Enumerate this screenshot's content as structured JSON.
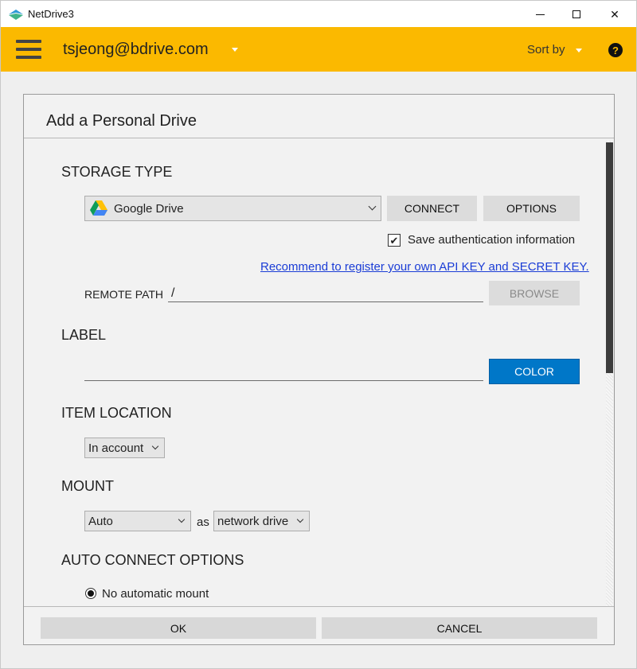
{
  "window": {
    "title": "NetDrive3"
  },
  "header": {
    "account": "tsjeong@bdrive.com",
    "sort_label": "Sort by",
    "help_glyph": "?"
  },
  "dialog": {
    "title": "Add a Personal Drive",
    "storage_type": {
      "heading": "STORAGE TYPE",
      "selected": "Google Drive",
      "connect_label": "CONNECT",
      "options_label": "OPTIONS",
      "save_auth_label": "Save authentication information",
      "save_auth_checked": true,
      "api_key_link": "Recommend to register your own API KEY and SECRET KEY.",
      "remote_path_label": "REMOTE PATH",
      "remote_path_value": "/",
      "browse_label": "BROWSE"
    },
    "label": {
      "heading": "LABEL",
      "value": "",
      "color_label": "COLOR"
    },
    "item_location": {
      "heading": "ITEM LOCATION",
      "selected": "In account"
    },
    "mount": {
      "heading": "MOUNT",
      "selected": "Auto",
      "as_label": "as",
      "type_selected": "network drive"
    },
    "auto_connect": {
      "heading": "AUTO CONNECT OPTIONS",
      "option_label": "No automatic mount",
      "option_selected": true
    },
    "ok_label": "OK",
    "cancel_label": "CANCEL"
  },
  "colors": {
    "accent": "#FBB900",
    "primary_button": "#0077C8",
    "link": "#1A3CD6"
  },
  "icons": [
    "netdrive-app-icon",
    "minimize-icon",
    "maximize-icon",
    "close-icon",
    "hamburger-menu-icon",
    "chevron-down-icon",
    "help-icon",
    "google-drive-icon",
    "checkbox-checked-icon",
    "radio-selected-icon"
  ]
}
